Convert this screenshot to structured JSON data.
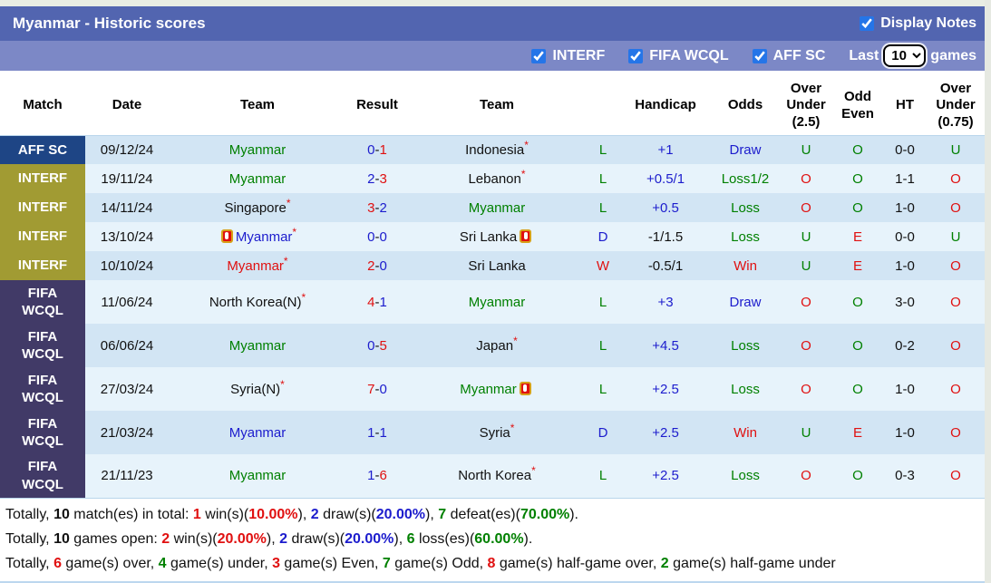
{
  "page": {
    "title": "Myanmar - Historic scores",
    "display_notes_label": "Display Notes",
    "display_notes_checked": true,
    "filters": [
      {
        "label": "INTERF",
        "checked": true
      },
      {
        "label": "FIFA WCQL",
        "checked": true
      },
      {
        "label": "AFF SC",
        "checked": true
      }
    ],
    "last_label": "Last",
    "last_value": "10",
    "games_label": "games"
  },
  "colors": {
    "titlebar": "#5265b0",
    "filterbar": "#7c88c6",
    "badge_affsc": "#1e4585",
    "badge_interf": "#a19b33",
    "badge_fifa": "#413a67",
    "row_odd": "#d2e5f4",
    "row_even": "#e7f3fb",
    "green": "#008000",
    "red": "#e01010",
    "blue": "#1c1ccd"
  },
  "table": {
    "headers": [
      "Match",
      "Date",
      "Team",
      "Result",
      "Team",
      "",
      "Handicap",
      "Odds",
      "Over\nUnder\n(2.5)",
      "Odd\nEven",
      "HT",
      "Over\nUnder\n(0.75)"
    ],
    "rows": [
      {
        "comp": "AFF SC",
        "comp_key": "affsc",
        "tall": false,
        "date": "09/12/24",
        "team1": {
          "name": "Myanmar",
          "color": "green",
          "star": false
        },
        "result": {
          "home": "0",
          "home_color": "blue",
          "away": "1",
          "away_color": "red"
        },
        "team2": {
          "name": "Indonesia",
          "color": "black",
          "star": true
        },
        "wld": {
          "text": "L",
          "color": "green"
        },
        "handicap": {
          "text": "+1",
          "color": "blue"
        },
        "odds": {
          "text": "Draw",
          "color": "blue"
        },
        "ou25": {
          "text": "U",
          "color": "green"
        },
        "oddeven": {
          "text": "O",
          "color": "green"
        },
        "ht": "0-0",
        "ou075": {
          "text": "U",
          "color": "green"
        }
      },
      {
        "comp": "INTERF",
        "comp_key": "interf",
        "tall": false,
        "date": "19/11/24",
        "team1": {
          "name": "Myanmar",
          "color": "green",
          "star": false
        },
        "result": {
          "home": "2",
          "home_color": "blue",
          "away": "3",
          "away_color": "red"
        },
        "team2": {
          "name": "Lebanon",
          "color": "black",
          "star": true
        },
        "wld": {
          "text": "L",
          "color": "green"
        },
        "handicap": {
          "text": "+0.5/1",
          "color": "blue"
        },
        "odds": {
          "text": "Loss1/2",
          "color": "green"
        },
        "ou25": {
          "text": "O",
          "color": "red"
        },
        "oddeven": {
          "text": "O",
          "color": "green"
        },
        "ht": "1-1",
        "ou075": {
          "text": "O",
          "color": "red"
        }
      },
      {
        "comp": "INTERF",
        "comp_key": "interf",
        "tall": false,
        "date": "14/11/24",
        "team1": {
          "name": "Singapore",
          "color": "black",
          "star": true
        },
        "result": {
          "home": "3",
          "home_color": "red",
          "away": "2",
          "away_color": "blue"
        },
        "team2": {
          "name": "Myanmar",
          "color": "green",
          "star": false
        },
        "wld": {
          "text": "L",
          "color": "green"
        },
        "handicap": {
          "text": "+0.5",
          "color": "blue"
        },
        "odds": {
          "text": "Loss",
          "color": "green"
        },
        "ou25": {
          "text": "O",
          "color": "red"
        },
        "oddeven": {
          "text": "O",
          "color": "green"
        },
        "ht": "1-0",
        "ou075": {
          "text": "O",
          "color": "red"
        }
      },
      {
        "comp": "INTERF",
        "comp_key": "interf",
        "tall": false,
        "date": "13/10/24",
        "team1": {
          "name": "Myanmar",
          "color": "blue",
          "star": true,
          "card_before": true
        },
        "result": {
          "home": "0",
          "home_color": "blue",
          "away": "0",
          "away_color": "blue"
        },
        "team2": {
          "name": "Sri Lanka",
          "color": "black",
          "star": false,
          "card_after": true
        },
        "wld": {
          "text": "D",
          "color": "blue"
        },
        "handicap": {
          "text": "-1/1.5",
          "color": "black"
        },
        "odds": {
          "text": "Loss",
          "color": "green"
        },
        "ou25": {
          "text": "U",
          "color": "green"
        },
        "oddeven": {
          "text": "E",
          "color": "red"
        },
        "ht": "0-0",
        "ou075": {
          "text": "U",
          "color": "green"
        }
      },
      {
        "comp": "INTERF",
        "comp_key": "interf",
        "tall": false,
        "date": "10/10/24",
        "team1": {
          "name": "Myanmar",
          "color": "red",
          "star": true
        },
        "result": {
          "home": "2",
          "home_color": "red",
          "away": "0",
          "away_color": "blue"
        },
        "team2": {
          "name": "Sri Lanka",
          "color": "black",
          "star": false
        },
        "wld": {
          "text": "W",
          "color": "red"
        },
        "handicap": {
          "text": "-0.5/1",
          "color": "black"
        },
        "odds": {
          "text": "Win",
          "color": "red"
        },
        "ou25": {
          "text": "U",
          "color": "green"
        },
        "oddeven": {
          "text": "E",
          "color": "red"
        },
        "ht": "1-0",
        "ou075": {
          "text": "O",
          "color": "red"
        }
      },
      {
        "comp": "FIFA\nWCQL",
        "comp_key": "fifa",
        "tall": true,
        "date": "11/06/24",
        "team1": {
          "name": "North Korea(N)",
          "color": "black",
          "star": true
        },
        "result": {
          "home": "4",
          "home_color": "red",
          "away": "1",
          "away_color": "blue"
        },
        "team2": {
          "name": "Myanmar",
          "color": "green",
          "star": false
        },
        "wld": {
          "text": "L",
          "color": "green"
        },
        "handicap": {
          "text": "+3",
          "color": "blue"
        },
        "odds": {
          "text": "Draw",
          "color": "blue"
        },
        "ou25": {
          "text": "O",
          "color": "red"
        },
        "oddeven": {
          "text": "O",
          "color": "green"
        },
        "ht": "3-0",
        "ou075": {
          "text": "O",
          "color": "red"
        }
      },
      {
        "comp": "FIFA\nWCQL",
        "comp_key": "fifa",
        "tall": true,
        "date": "06/06/24",
        "team1": {
          "name": "Myanmar",
          "color": "green",
          "star": false
        },
        "result": {
          "home": "0",
          "home_color": "blue",
          "away": "5",
          "away_color": "red"
        },
        "team2": {
          "name": "Japan",
          "color": "black",
          "star": true
        },
        "wld": {
          "text": "L",
          "color": "green"
        },
        "handicap": {
          "text": "+4.5",
          "color": "blue"
        },
        "odds": {
          "text": "Loss",
          "color": "green"
        },
        "ou25": {
          "text": "O",
          "color": "red"
        },
        "oddeven": {
          "text": "O",
          "color": "green"
        },
        "ht": "0-2",
        "ou075": {
          "text": "O",
          "color": "red"
        }
      },
      {
        "comp": "FIFA\nWCQL",
        "comp_key": "fifa",
        "tall": true,
        "date": "27/03/24",
        "team1": {
          "name": "Syria(N)",
          "color": "black",
          "star": true
        },
        "result": {
          "home": "7",
          "home_color": "red",
          "away": "0",
          "away_color": "blue"
        },
        "team2": {
          "name": "Myanmar",
          "color": "green",
          "star": false,
          "card_after": true
        },
        "wld": {
          "text": "L",
          "color": "green"
        },
        "handicap": {
          "text": "+2.5",
          "color": "blue"
        },
        "odds": {
          "text": "Loss",
          "color": "green"
        },
        "ou25": {
          "text": "O",
          "color": "red"
        },
        "oddeven": {
          "text": "O",
          "color": "green"
        },
        "ht": "1-0",
        "ou075": {
          "text": "O",
          "color": "red"
        }
      },
      {
        "comp": "FIFA\nWCQL",
        "comp_key": "fifa",
        "tall": true,
        "date": "21/03/24",
        "team1": {
          "name": "Myanmar",
          "color": "blue",
          "star": false
        },
        "result": {
          "home": "1",
          "home_color": "blue",
          "away": "1",
          "away_color": "blue"
        },
        "team2": {
          "name": "Syria",
          "color": "black",
          "star": true
        },
        "wld": {
          "text": "D",
          "color": "blue"
        },
        "handicap": {
          "text": "+2.5",
          "color": "blue"
        },
        "odds": {
          "text": "Win",
          "color": "red"
        },
        "ou25": {
          "text": "U",
          "color": "green"
        },
        "oddeven": {
          "text": "E",
          "color": "red"
        },
        "ht": "1-0",
        "ou075": {
          "text": "O",
          "color": "red"
        }
      },
      {
        "comp": "FIFA\nWCQL",
        "comp_key": "fifa",
        "tall": true,
        "date": "21/11/23",
        "team1": {
          "name": "Myanmar",
          "color": "green",
          "star": false
        },
        "result": {
          "home": "1",
          "home_color": "blue",
          "away": "6",
          "away_color": "red"
        },
        "team2": {
          "name": "North Korea",
          "color": "black",
          "star": true
        },
        "wld": {
          "text": "L",
          "color": "green"
        },
        "handicap": {
          "text": "+2.5",
          "color": "blue"
        },
        "odds": {
          "text": "Loss",
          "color": "green"
        },
        "ou25": {
          "text": "O",
          "color": "red"
        },
        "oddeven": {
          "text": "O",
          "color": "green"
        },
        "ht": "0-3",
        "ou075": {
          "text": "O",
          "color": "red"
        }
      }
    ]
  },
  "summary": [
    [
      {
        "t": "Totally, "
      },
      {
        "t": "10",
        "b": true
      },
      {
        "t": " match(es) in total: "
      },
      {
        "t": "1",
        "c": "red",
        "b": true
      },
      {
        "t": " win(s)("
      },
      {
        "t": "10.00%",
        "c": "red",
        "b": true
      },
      {
        "t": "), "
      },
      {
        "t": "2",
        "c": "blue",
        "b": true
      },
      {
        "t": " draw(s)("
      },
      {
        "t": "20.00%",
        "c": "blue",
        "b": true
      },
      {
        "t": "), "
      },
      {
        "t": "7",
        "c": "green",
        "b": true
      },
      {
        "t": " defeat(es)("
      },
      {
        "t": "70.00%",
        "c": "green",
        "b": true
      },
      {
        "t": ")."
      }
    ],
    [
      {
        "t": "Totally, "
      },
      {
        "t": "10",
        "b": true
      },
      {
        "t": " games open: "
      },
      {
        "t": "2",
        "c": "red",
        "b": true
      },
      {
        "t": " win(s)("
      },
      {
        "t": "20.00%",
        "c": "red",
        "b": true
      },
      {
        "t": "), "
      },
      {
        "t": "2",
        "c": "blue",
        "b": true
      },
      {
        "t": " draw(s)("
      },
      {
        "t": "20.00%",
        "c": "blue",
        "b": true
      },
      {
        "t": "), "
      },
      {
        "t": "6",
        "c": "green",
        "b": true
      },
      {
        "t": " loss(es)("
      },
      {
        "t": "60.00%",
        "c": "green",
        "b": true
      },
      {
        "t": ")."
      }
    ],
    [
      {
        "t": "Totally, "
      },
      {
        "t": "6",
        "c": "red",
        "b": true
      },
      {
        "t": " game(s) over, "
      },
      {
        "t": "4",
        "c": "green",
        "b": true
      },
      {
        "t": " game(s) under, "
      },
      {
        "t": "3",
        "c": "red",
        "b": true
      },
      {
        "t": " game(s) Even, "
      },
      {
        "t": "7",
        "c": "green",
        "b": true
      },
      {
        "t": " game(s) Odd, "
      },
      {
        "t": "8",
        "c": "red",
        "b": true
      },
      {
        "t": " game(s) half-game over, "
      },
      {
        "t": "2",
        "c": "green",
        "b": true
      },
      {
        "t": " game(s) half-game under"
      }
    ]
  ]
}
